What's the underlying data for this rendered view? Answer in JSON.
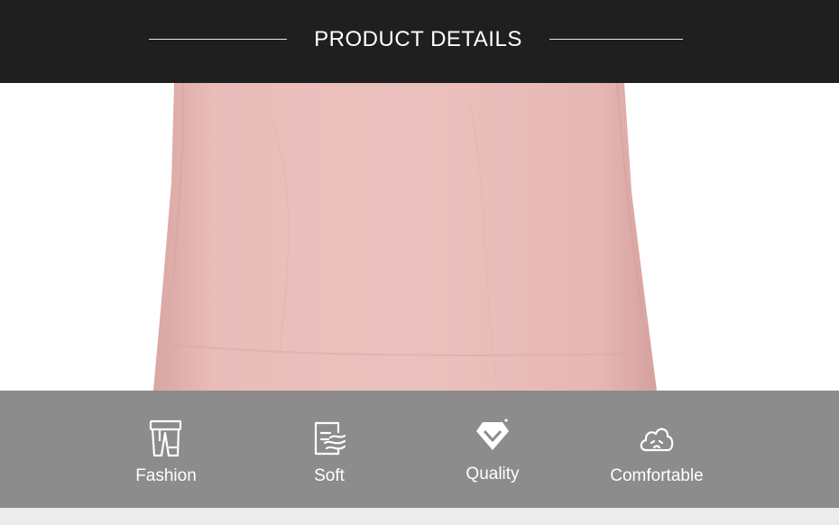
{
  "header": {
    "title": "PRODUCT DETAILS"
  },
  "product_image": {
    "description_icon": "pink-garment-photo",
    "color": "#e7b9b6"
  },
  "features": [
    {
      "label": "Fashion",
      "icon": "trousers-icon"
    },
    {
      "label": "Soft",
      "icon": "soft-fabric-icon"
    },
    {
      "label": "Quality",
      "icon": "diamond-icon"
    },
    {
      "label": "Comfortable",
      "icon": "cloud-face-icon"
    }
  ],
  "colors": {
    "header_bg": "#1f1f1f",
    "features_bg": "#8c8c8c",
    "fabric": "#e7b9b6"
  }
}
